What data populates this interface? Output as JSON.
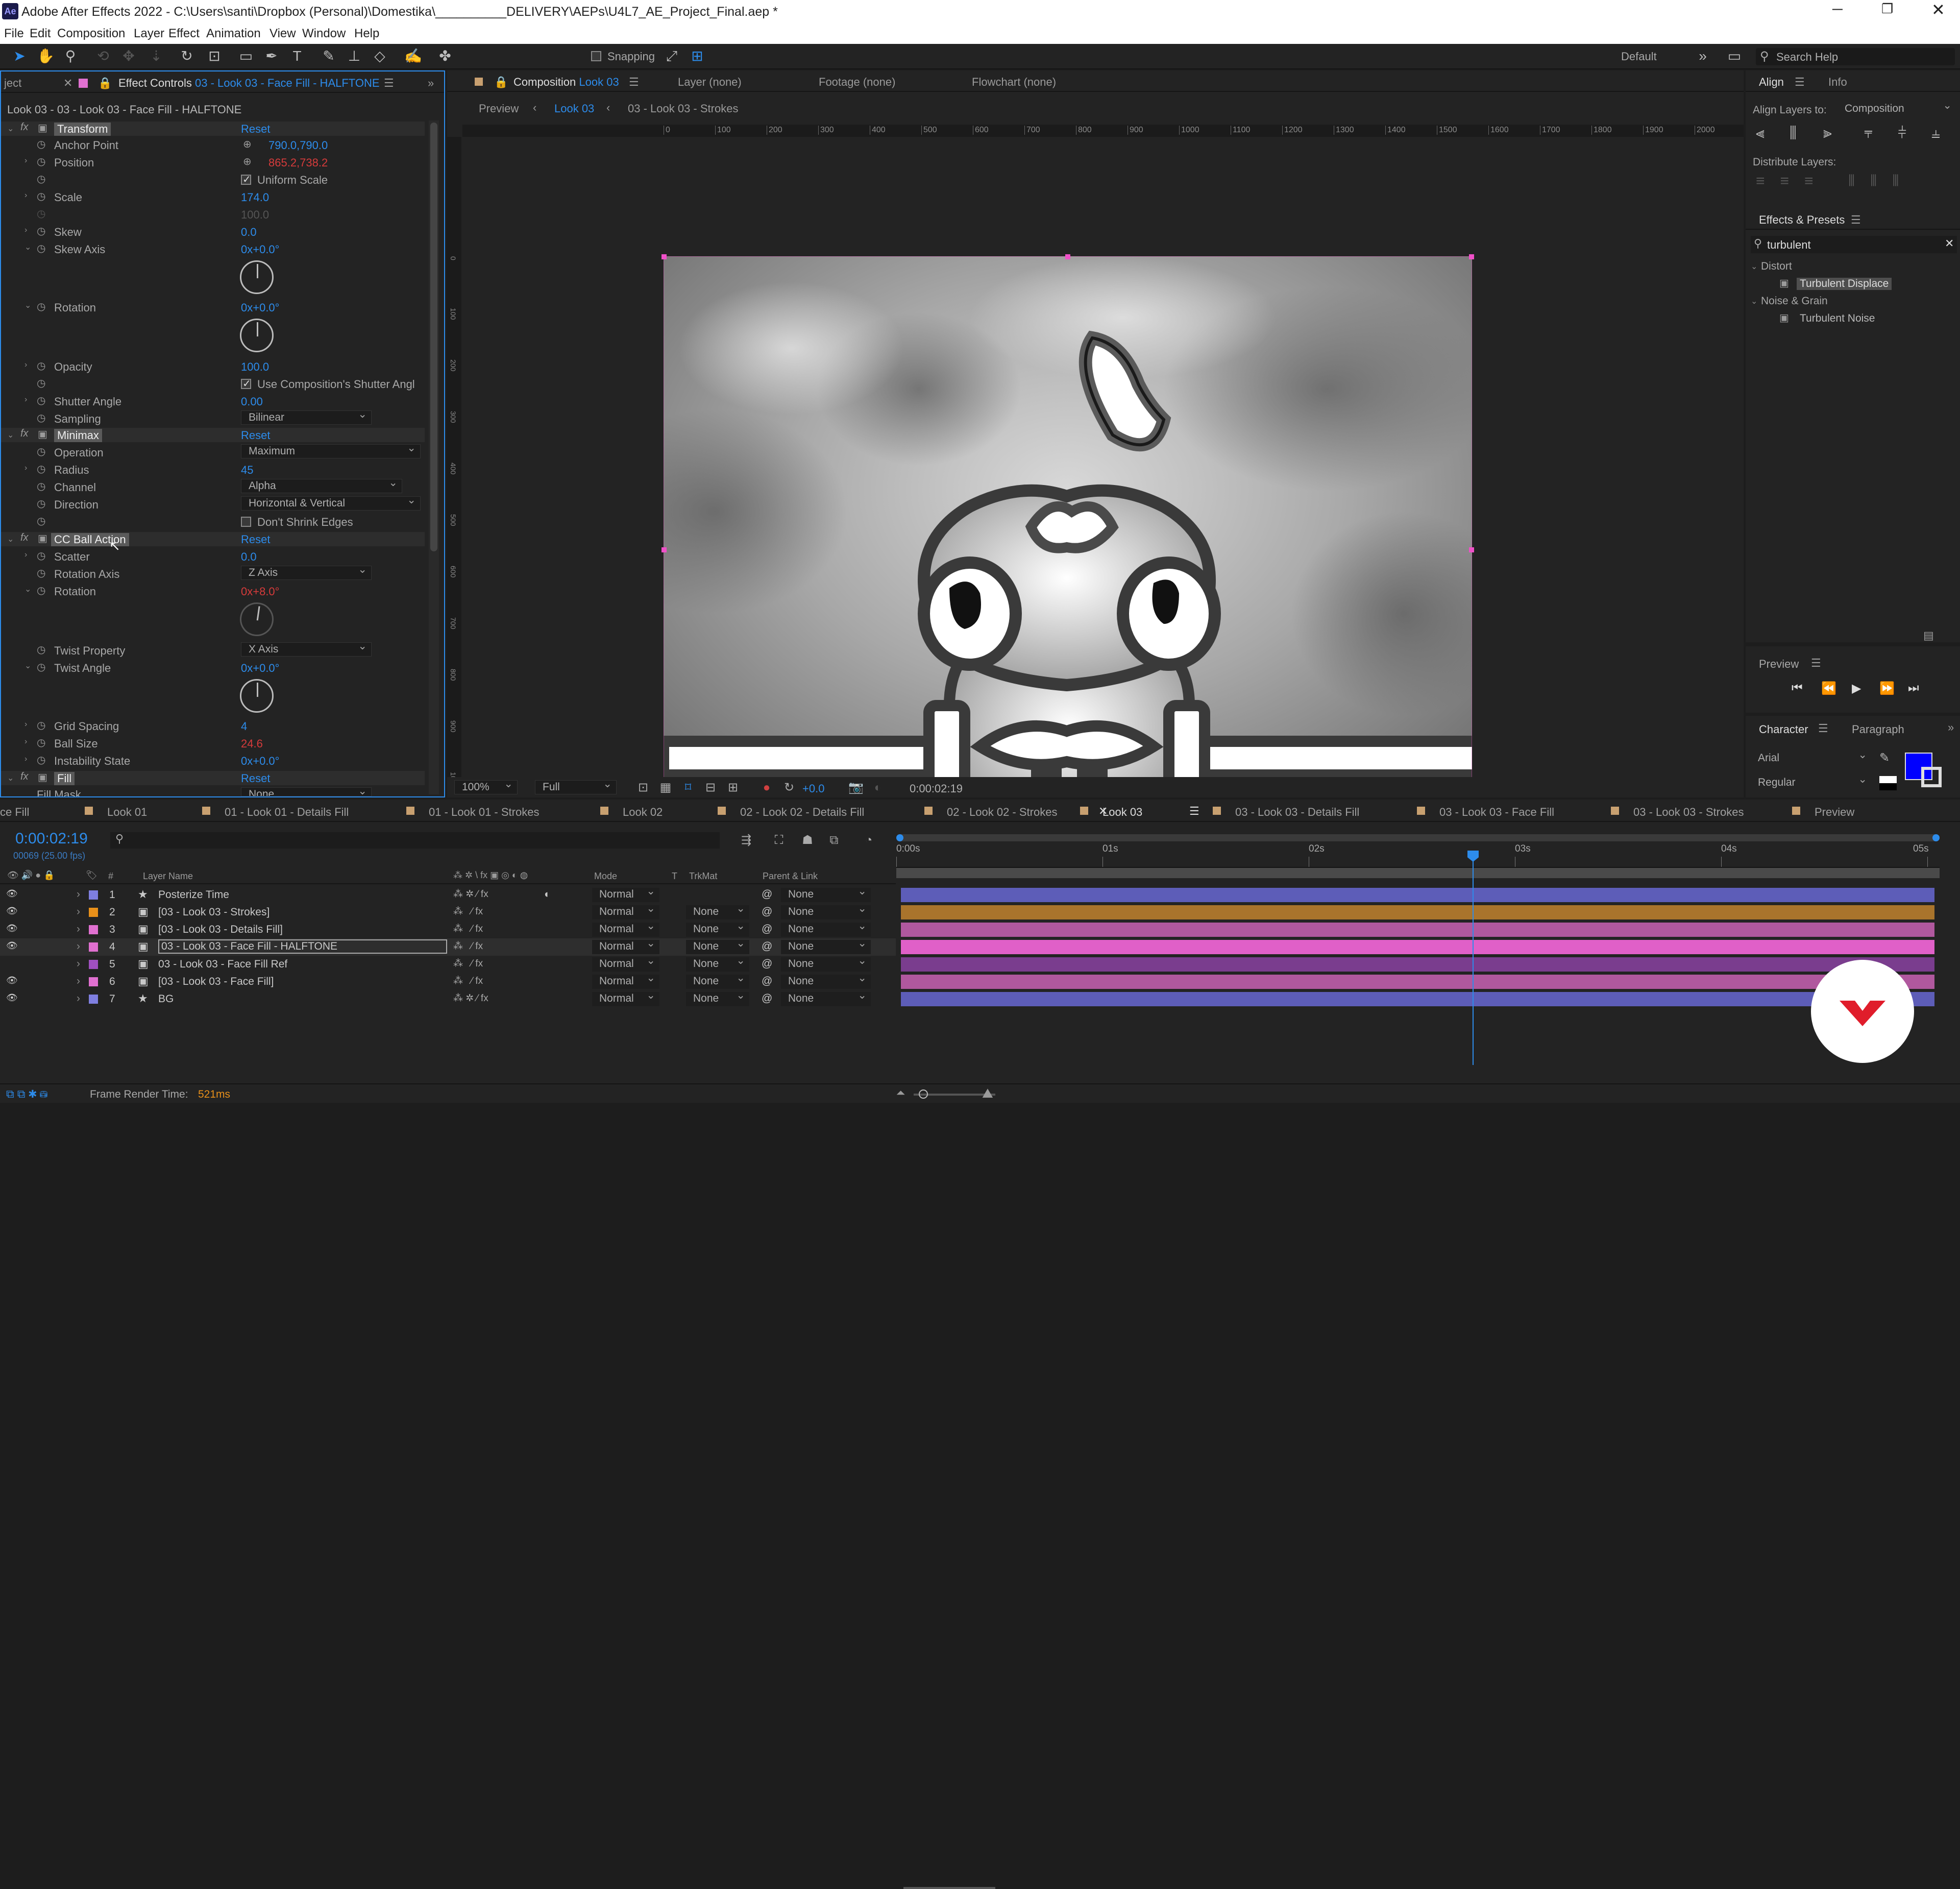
{
  "app": {
    "title": "Adobe After Effects 2022 - C:\\Users\\santi\\Dropbox (Personal)\\Domestika\\__________DELIVERY\\AEPs\\U4L7_AE_Project_Final.aep *",
    "logo": "Ae"
  },
  "menu": [
    "File",
    "Edit",
    "Composition",
    "Layer",
    "Effect",
    "Animation",
    "View",
    "Window",
    "Help"
  ],
  "toolbar": {
    "snapping": "Snapping",
    "workspace": "Default",
    "search": "Search Help"
  },
  "effect_controls": {
    "tab_left": "ject",
    "tab_title": "Effect Controls",
    "tab_layer": "03 - Look 03 - Face Fill - HALFTONE",
    "breadcrumb": "Look 03 - 03 - Look 03 - Face Fill - HALFTONE",
    "reset": "Reset",
    "transform": {
      "name": "Transform",
      "anchor_label": "Anchor Point",
      "anchor_val": "790.0,790.0",
      "position_label": "Position",
      "position_val": "865.2,738.2",
      "uniform": "Uniform Scale",
      "scale_label": "Scale",
      "scale_val": "174.0",
      "scale2_val": "100.0",
      "skew_label": "Skew",
      "skew_val": "0.0",
      "skewaxis_label": "Skew Axis",
      "skewaxis_val": "0x+0.0°",
      "rotation_label": "Rotation",
      "rotation_val": "0x+0.0°",
      "opacity_label": "Opacity",
      "opacity_val": "100.0",
      "shutter_chk": "Use Composition's Shutter Angl",
      "shutter_label": "Shutter Angle",
      "shutter_val": "0.00",
      "sampling_label": "Sampling",
      "sampling_val": "Bilinear"
    },
    "minimax": {
      "name": "Minimax",
      "operation_label": "Operation",
      "operation_val": "Maximum",
      "radius_label": "Radius",
      "radius_val": "45",
      "channel_label": "Channel",
      "channel_val": "Alpha",
      "direction_label": "Direction",
      "direction_val": "Horizontal & Vertical",
      "dont_shrink": "Don't Shrink Edges"
    },
    "ccball": {
      "name": "CC Ball Action",
      "scatter_label": "Scatter",
      "scatter_val": "0.0",
      "rotaxis_label": "Rotation Axis",
      "rotaxis_val": "Z Axis",
      "rotation_label": "Rotation",
      "rotation_val": "0x+8.0°",
      "twistprop_label": "Twist Property",
      "twistprop_val": "X Axis",
      "twistangle_label": "Twist Angle",
      "twistangle_val": "0x+0.0°",
      "grid_label": "Grid Spacing",
      "grid_val": "4",
      "ballsize_label": "Ball Size",
      "ballsize_val": "24.6",
      "instab_label": "Instability State",
      "instab_val": "0x+0.0°"
    },
    "fill": {
      "name": "Fill",
      "mask_label": "Fill Mask",
      "mask_val": "None"
    }
  },
  "composition": {
    "tab_title": "Composition",
    "tab_comp": "Look 03",
    "layer_tab": "Layer  (none)",
    "footage_tab": "Footage  (none)",
    "flowchart_tab": "Flowchart  (none)",
    "preview_btn": "Preview",
    "crumb1": "Look 03",
    "crumb2": "03 - Look 03 - Strokes",
    "ruler": [
      "0",
      "100",
      "200",
      "300",
      "400",
      "500",
      "600",
      "700",
      "800",
      "900",
      "1000",
      "1100",
      "1200",
      "1300",
      "1400",
      "1500",
      "1600",
      "1700",
      "1800",
      "1900",
      "2000"
    ],
    "vruler": [
      "0",
      "100",
      "200",
      "300",
      "400",
      "500",
      "600",
      "700",
      "800",
      "900",
      "1000",
      "1100"
    ],
    "zoom": "100%",
    "resolution": "Full",
    "exposure": "+0.0",
    "timecode": "0:00:02:19"
  },
  "align": {
    "tab": "Align",
    "info_tab": "Info",
    "align_to_label": "Align Layers to:",
    "align_to_val": "Composition",
    "distribute": "Distribute Layers:"
  },
  "effects_presets": {
    "title": "Effects & Presets",
    "search": "turbulent",
    "groups": [
      {
        "name": "Distort",
        "items": [
          "Turbulent Displace"
        ]
      },
      {
        "name": "Noise & Grain",
        "items": [
          "Turbulent Noise"
        ]
      }
    ]
  },
  "preview_panel": {
    "title": "Preview"
  },
  "character": {
    "tab": "Character",
    "paragraph_tab": "Paragraph",
    "font": "Arial",
    "style": "Regular",
    "fill_color": "#0000ff"
  },
  "timeline": {
    "tabs": [
      "ce Fill",
      "Look 01",
      "01 - Look 01 - Details Fill",
      "01 - Look 01 - Strokes",
      "Look 02",
      "02 - Look 02 - Details Fill",
      "02 - Look 02 - Strokes",
      "Look 03",
      "03 - Look 03 - Details Fill",
      "03 - Look 03 - Face Fill",
      "03 - Look 03 - Strokes",
      "Preview"
    ],
    "tab_colors": [
      "#c8a070",
      "#c8a070",
      "#c8a070",
      "#c8a070",
      "#c8a070",
      "#c8a070",
      "#c8a070",
      "#c8a070",
      "#c8a070",
      "#c8a070",
      "#c8a070",
      "#c8a070"
    ],
    "timecode": "0:00:02:19",
    "frames": "00069 (25.00 fps)",
    "col_layer": "Layer Name",
    "col_mode": "Mode",
    "col_t": "T",
    "col_trk": "TrkMat",
    "col_parent": "Parent & Link",
    "col_num": "#",
    "ticks": [
      "0:00s",
      "01s",
      "02s",
      "03s",
      "04s",
      "05s"
    ],
    "layers": [
      {
        "num": "1",
        "name": "Posterize Time",
        "color": "#7f7fe0",
        "mode": "Normal",
        "trk": "",
        "parent": "None",
        "bar": "#5d5db8"
      },
      {
        "num": "2",
        "name": "[03 - Look 03 - Strokes]",
        "color": "#e8901a",
        "mode": "Normal",
        "trk": "None",
        "parent": "None",
        "bar": "#a9742c"
      },
      {
        "num": "3",
        "name": "[03 - Look 03 - Details Fill]",
        "color": "#e070d0",
        "mode": "Normal",
        "trk": "None",
        "parent": "None",
        "bar": "#b0589e"
      },
      {
        "num": "4",
        "name": "03 - Look 03 - Face Fill - HALFTONE",
        "color": "#e070d0",
        "mode": "Normal",
        "trk": "None",
        "parent": "None",
        "bar": "#e060c8"
      },
      {
        "num": "5",
        "name": "03 - Look 03 - Face Fill Ref",
        "color": "#a050c0",
        "mode": "Normal",
        "trk": "None",
        "parent": "None",
        "bar": "#7a3d8e"
      },
      {
        "num": "6",
        "name": "[03 - Look 03 - Face Fill]",
        "color": "#e070d0",
        "mode": "Normal",
        "trk": "None",
        "parent": "None",
        "bar": "#b0589e"
      },
      {
        "num": "7",
        "name": "BG",
        "color": "#7f7fe0",
        "mode": "Normal",
        "trk": "None",
        "parent": "None",
        "bar": "#5d5db8"
      }
    ],
    "playhead_fraction": 0.553,
    "render_time_label": "Frame Render Time:",
    "render_time": "521ms"
  }
}
